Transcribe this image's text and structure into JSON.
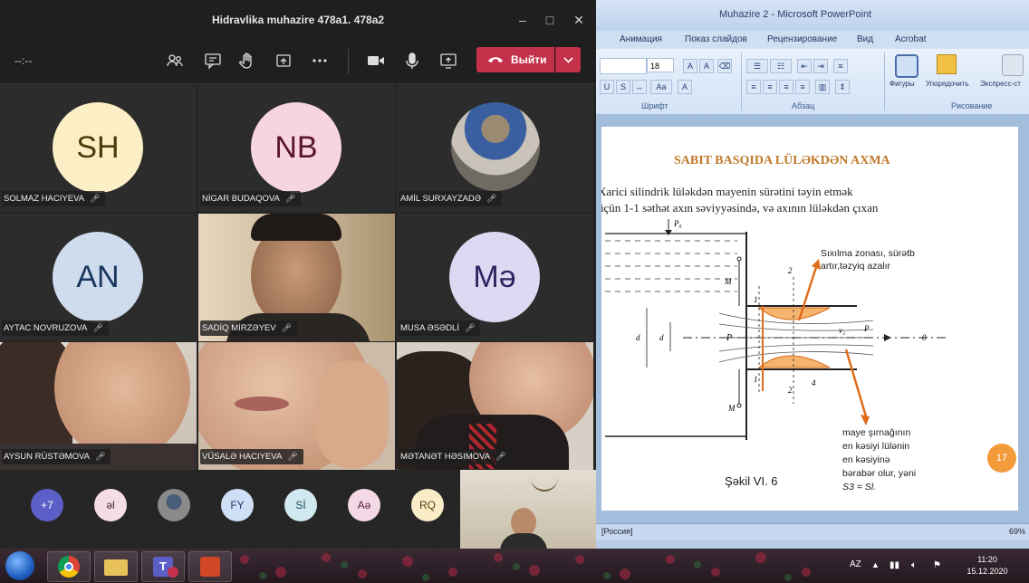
{
  "teams": {
    "title": "Hidravlika muhazire 478a1. 478a2",
    "timer": "--:--",
    "leave_label": "Выйти",
    "accent_leave": "#c4314b",
    "toolbar_icons": [
      "participants-icon",
      "chat-icon",
      "raise-hand-icon",
      "share-tray-icon",
      "more-options-icon",
      "camera-icon",
      "microphone-icon",
      "share-screen-icon"
    ],
    "tiles": [
      {
        "name": "SOLMAZ HACIYEVA",
        "initials": "SH",
        "bg": "#fcefc6",
        "fg": "#4a3b08"
      },
      {
        "name": "NİGAR BUDAQOVA",
        "initials": "NB",
        "bg": "#f7d5e0",
        "fg": "#5a1530"
      },
      {
        "name": "AMİL SURXAYZADƏ"
      },
      {
        "name": "AYTAC NOVRUZOVA",
        "initials": "AN",
        "bg": "#cfdcee",
        "fg": "#18365e"
      },
      {
        "name": "SADİQ MİRZƏYEV"
      },
      {
        "name": "MUSA ƏSƏDLİ",
        "initials": "Mə",
        "bg": "#ded8f2",
        "fg": "#2d2460"
      },
      {
        "name": "AYSUN RÜSTƏMOVA"
      },
      {
        "name": "VÜSALƏ HACIYEVA"
      },
      {
        "name": "MƏTANƏT HƏSIMOVA"
      }
    ],
    "overflow": {
      "more_count": "+7",
      "avatars": [
        {
          "initials": "əl",
          "bg": "#f5dde4",
          "fg": "#4a2030"
        },
        {
          "initials": "",
          "bg": "#8a8a8a",
          "fg": "#fff"
        },
        {
          "initials": "FY",
          "bg": "#cfe0f6",
          "fg": "#1e3a66"
        },
        {
          "initials": "Sİ",
          "bg": "#d2e8f0",
          "fg": "#1b4a5e"
        },
        {
          "initials": "Aə",
          "bg": "#f4d8e6",
          "fg": "#5a1d3a"
        },
        {
          "initials": "RQ",
          "bg": "#fbecc8",
          "fg": "#5a4410"
        }
      ]
    }
  },
  "ppt": {
    "window_title": "Muhazire 2 - Microsoft PowerPoint",
    "tabs": [
      "Анимация",
      "Показ слайдов",
      "Рецензирование",
      "Вид",
      "Acrobat"
    ],
    "font_size": "18",
    "groups": [
      "Шрифт",
      "Абзац",
      "Рисование"
    ],
    "buttons": [
      "Фигуры",
      "Упорядочить",
      "Экспресс-ст"
    ],
    "slide": {
      "title": "SABIT BASQIDA LÜLƏKDƏN AXMA",
      "line1": "Xarici silindrik lüləkdən mayenin sürətini təyin etmək",
      "line2": "üçün 1-1 səthət axın səviyyəsində, və axının lüləkdən çıxan",
      "ann_suction": "Sıxılma zonası, sürətb",
      "ann_suction2": "artır,təzyiq azalır",
      "ann_bottom1": "maye şırnağının",
      "ann_bottom2": "en kəsiyi lülənin",
      "ann_bottom3": "en kəsiyinə",
      "ann_bottom4": "bərabər olur, yəni",
      "ann_bottom5": "S3 = Sl.",
      "caption": "Şəkil VI. 6",
      "slide_number": "17",
      "labels": {
        "p_top": "P₀",
        "m_top": "M",
        "m_bot": "M",
        "d": "d",
        "n1": "1",
        "n2": "2",
        "n3": "3",
        "n4": "4",
        "p": "P",
        "v_out": "v₂",
        "p2": "P",
        "zero": "0"
      }
    },
    "status_lang": "[Россия]",
    "zoom": "69%"
  },
  "taskbar": {
    "lang": "AZ",
    "time": "11:20",
    "date": "15.12.2020",
    "apps": [
      "ie-icon",
      "chrome-icon",
      "explorer-icon",
      "teams-icon",
      "powerpoint-icon"
    ]
  }
}
